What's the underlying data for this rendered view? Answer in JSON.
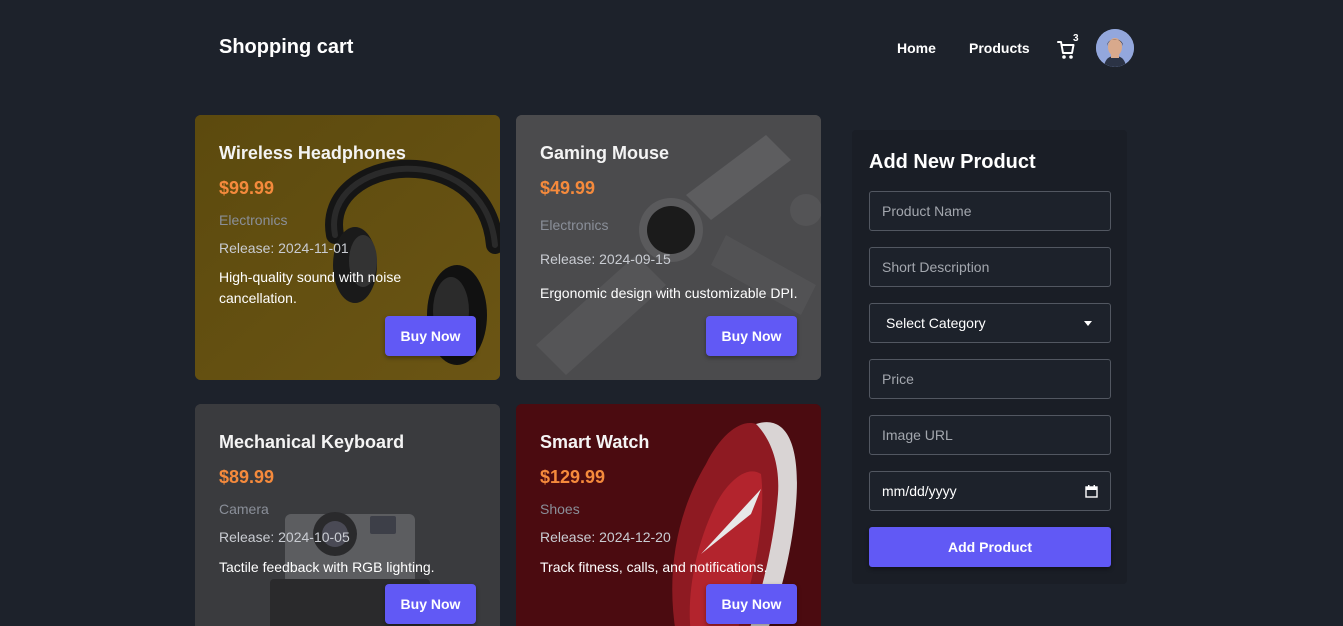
{
  "header": {
    "brand": "Shopping cart",
    "nav": {
      "home": "Home",
      "products": "Products"
    },
    "cart_count": "3",
    "cart_icon": "cart-icon",
    "avatar": "user-avatar"
  },
  "products": [
    {
      "title": "Wireless Headphones",
      "price": "$99.99",
      "category": "Electronics",
      "release": "Release: 2024-11-01",
      "description": "High-quality sound with noise cancellation.",
      "button": "Buy Now",
      "image": "headphones-image",
      "bg": "#5a4710"
    },
    {
      "title": "Gaming Mouse",
      "price": "$49.99",
      "category": "Electronics",
      "release": "Release: 2024-09-15",
      "description": "Ergonomic design with customizable DPI.",
      "button": "Buy Now",
      "image": "watch-image",
      "bg": "#4a4a4c"
    },
    {
      "title": "Mechanical Keyboard",
      "price": "$89.99",
      "category": "Camera",
      "release": "Release: 2024-10-05",
      "description": "Tactile feedback with RGB lighting.",
      "button": "Buy Now",
      "image": "camera-image",
      "bg": "#3a3b3e"
    },
    {
      "title": "Smart Watch",
      "price": "$129.99",
      "category": "Shoes",
      "release": "Release: 2024-12-20",
      "description": "Track fitness, calls, and notifications.",
      "button": "Buy Now",
      "image": "sneaker-image",
      "bg": "#4a0c10"
    }
  ],
  "form": {
    "title": "Add New Product",
    "name_placeholder": "Product Name",
    "description_placeholder": "Short Description",
    "category_selected": "Select Category",
    "price_placeholder": "Price",
    "image_placeholder": "Image URL",
    "date_placeholder": "mm/dd/yyyy",
    "submit": "Add Product"
  },
  "colors": {
    "page_bg": "#1d222b",
    "accent": "#6159f5",
    "price": "#f58a3c"
  }
}
